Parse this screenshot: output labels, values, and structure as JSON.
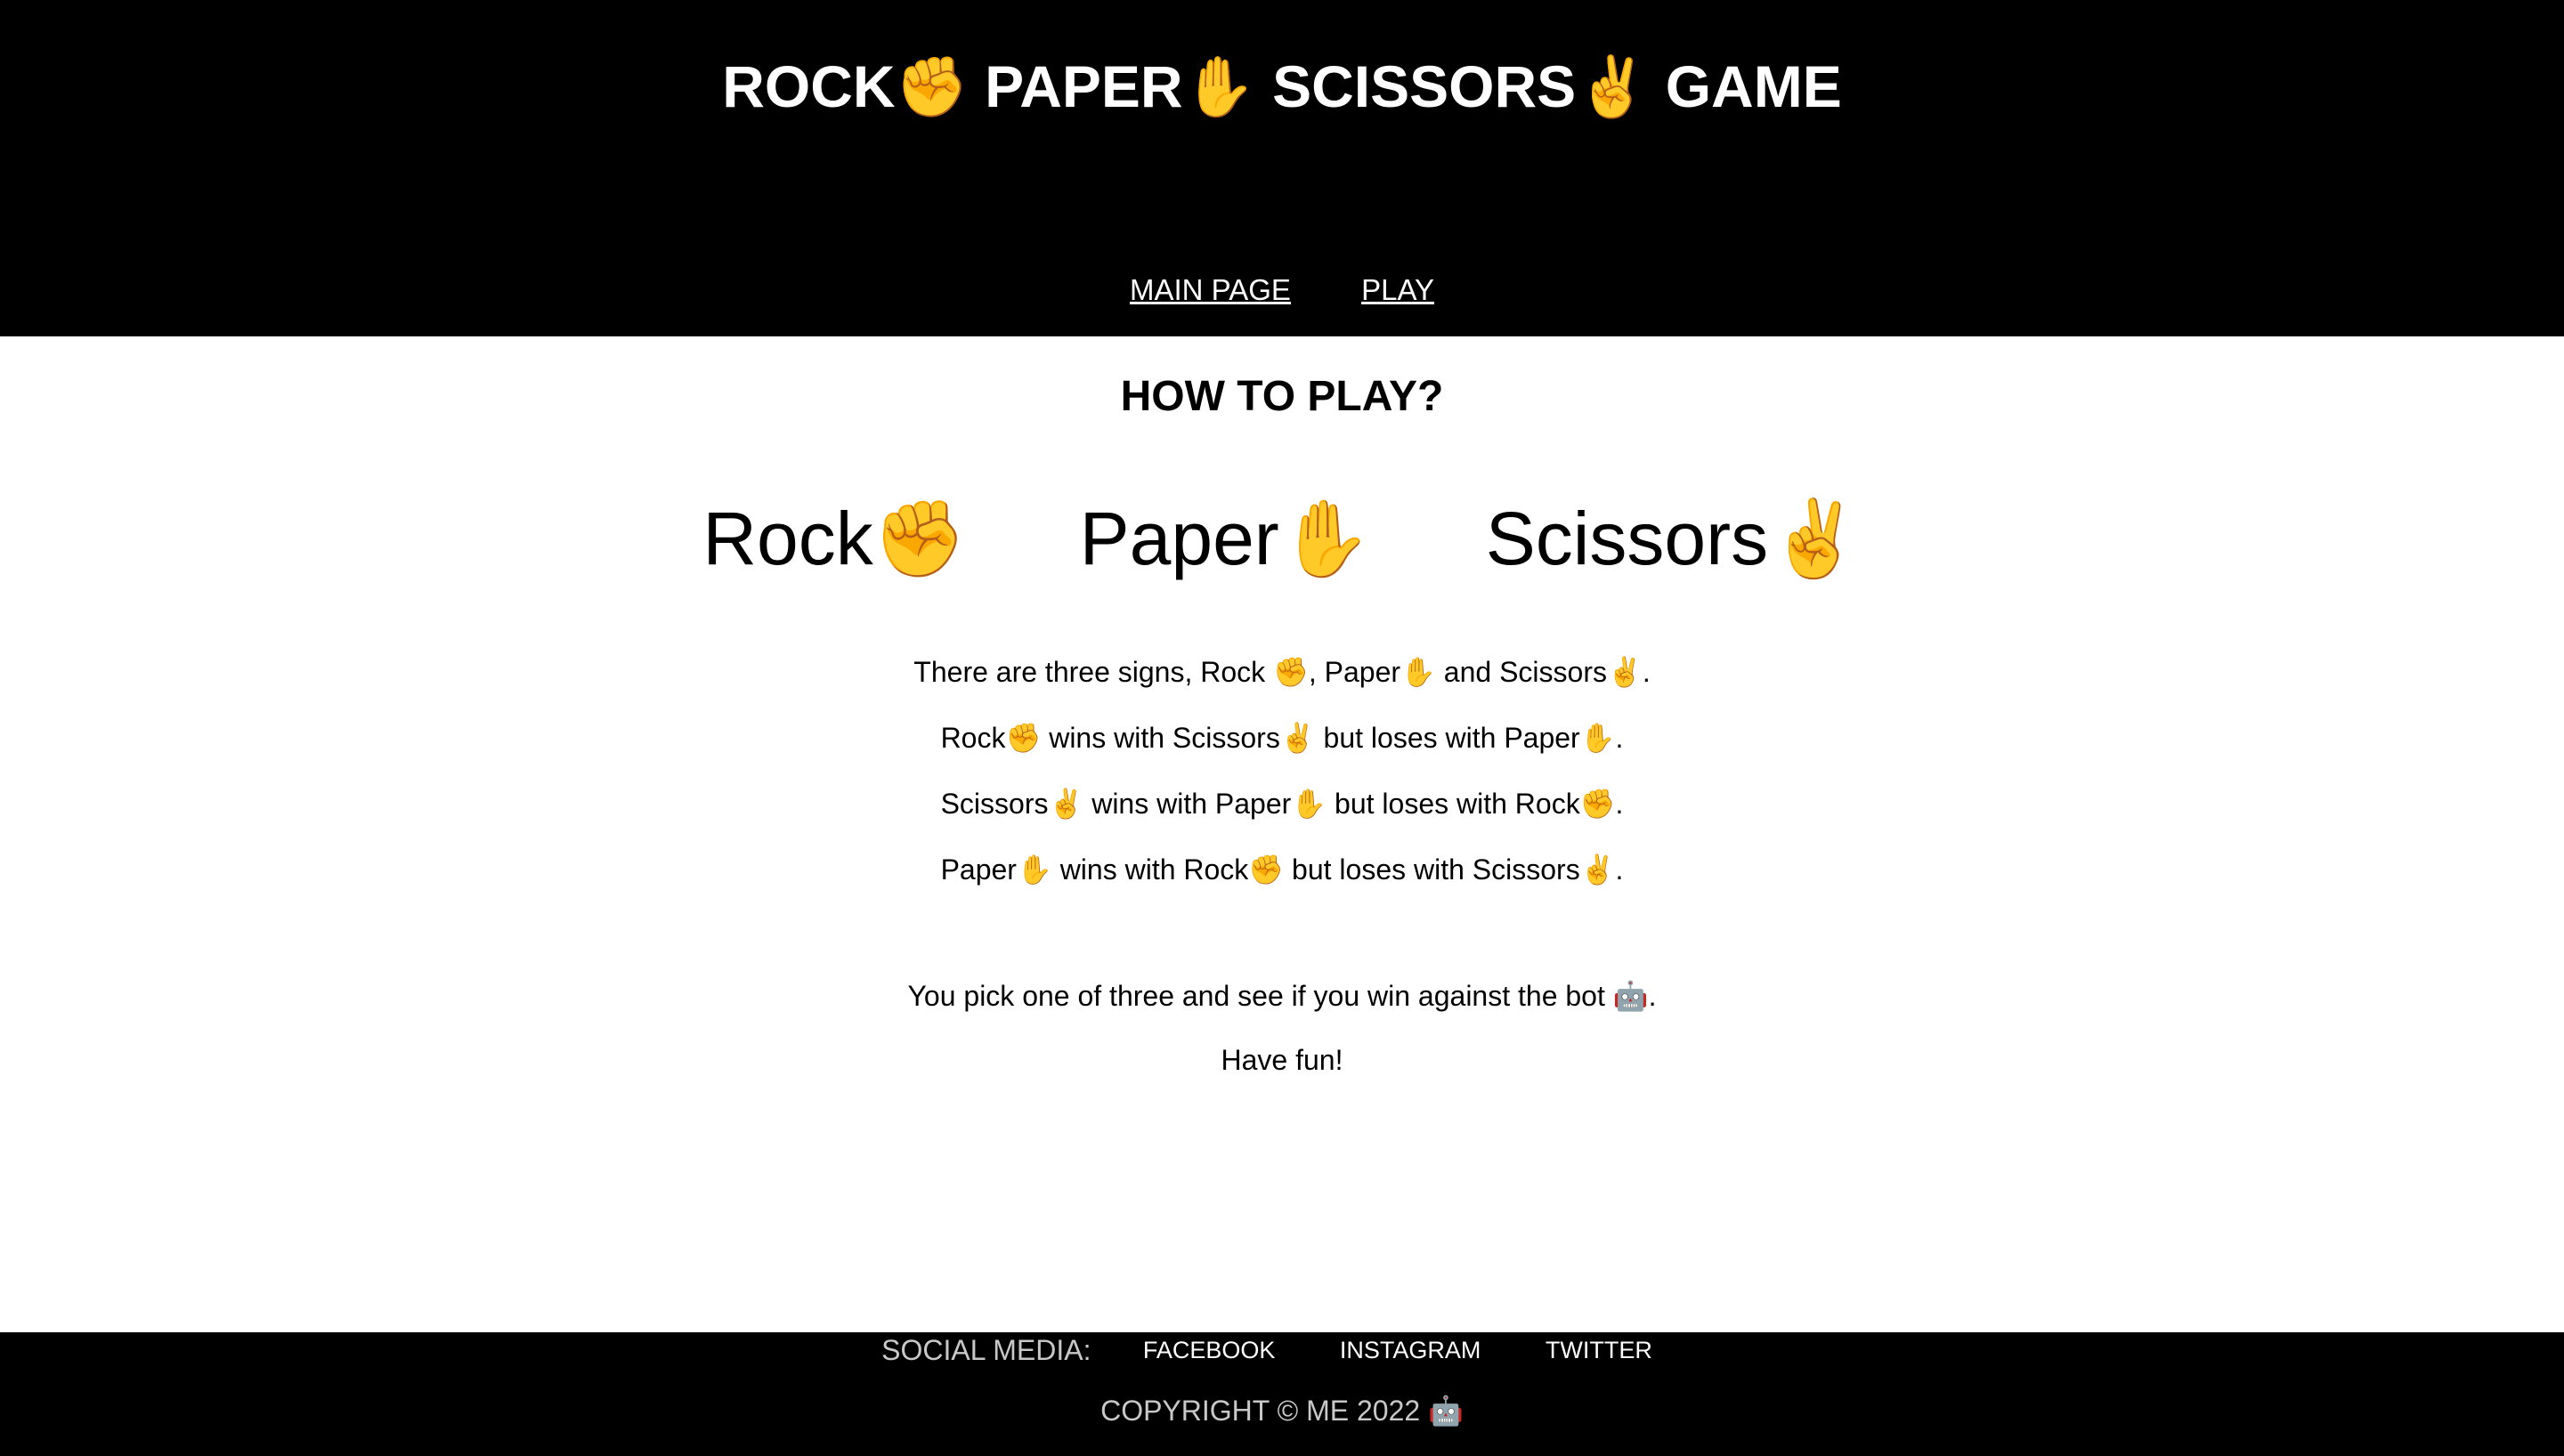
{
  "header": {
    "title": "ROCK✊ PAPER✋ SCISSORS✌️ GAME",
    "nav": {
      "main_page": "MAIN PAGE",
      "play": "PLAY"
    }
  },
  "main": {
    "heading": "HOW TO PLAY?",
    "signs": {
      "rock": "Rock✊",
      "paper": "Paper✋",
      "scissors": "Scissors✌️"
    },
    "rules": [
      "There are three signs, Rock ✊, Paper✋ and Scissors✌️.",
      "Rock✊ wins with Scissors✌️ but loses with Paper✋.",
      "Scissors✌️ wins with Paper✋ but loses with Rock✊.",
      "Paper✋ wins with Rock✊ but loses with Scissors✌️."
    ],
    "instructions": "You pick one of three and see if you win against the bot 🤖.",
    "closing": "Have fun!"
  },
  "footer": {
    "social_label": "SOCIAL MEDIA:",
    "links": {
      "facebook": "FACEBOOK",
      "instagram": "INSTAGRAM",
      "twitter": "TWITTER"
    },
    "copyright": "COPYRIGHT © ME 2022 🤖"
  },
  "colors": {
    "header_bg": "#000000",
    "footer_bg": "#000000",
    "page_bg": "#ffffff",
    "header_text": "#ffffff",
    "footer_muted_text": "#c8c8c8"
  }
}
